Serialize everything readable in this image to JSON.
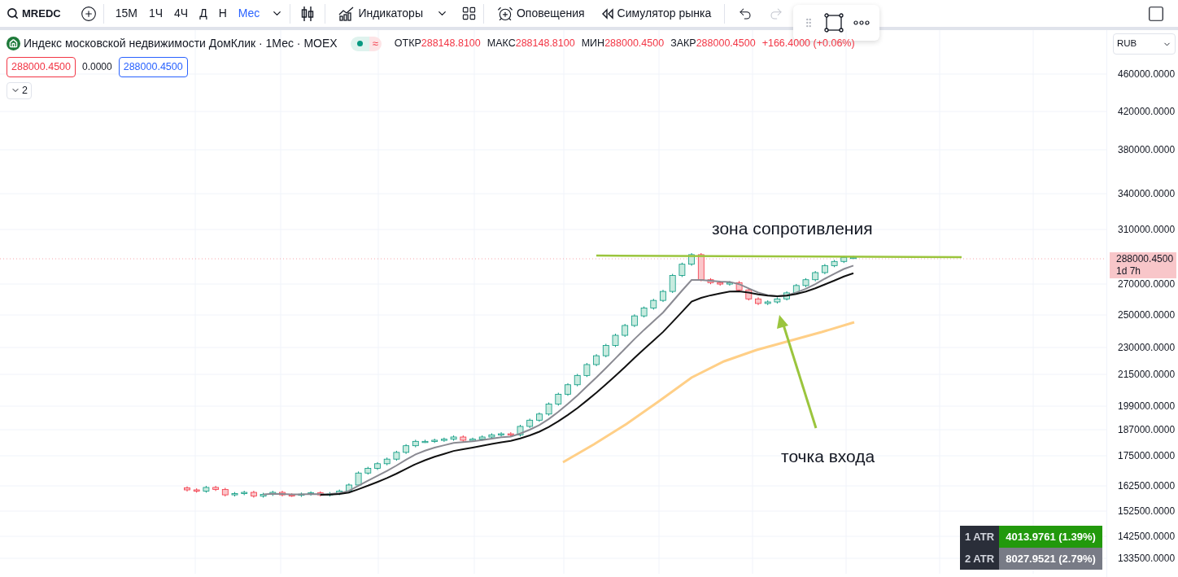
{
  "toolbar": {
    "symbol": "MREDC",
    "intervals": [
      {
        "label": "15М",
        "selected": false
      },
      {
        "label": "1Ч",
        "selected": false
      },
      {
        "label": "4Ч",
        "selected": false
      },
      {
        "label": "Д",
        "selected": false
      },
      {
        "label": "Н",
        "selected": false
      },
      {
        "label": "Мес",
        "selected": true
      }
    ],
    "indicators_label": "Индикаторы",
    "alerts_label": "Оповещения",
    "replay_label": "Симулятор рынка"
  },
  "legend": {
    "title": "Индекс московской недвижимости ДомКлик · 1Мес · MOEX",
    "ohlc": [
      {
        "label": "ОТКР",
        "value": "288148.8100"
      },
      {
        "label": "МАКС",
        "value": "288148.8100"
      },
      {
        "label": "МИН",
        "value": "288000.4500"
      },
      {
        "label": "ЗАКР",
        "value": "288000.4500"
      }
    ],
    "status_symbol": "≈",
    "change": "+166.4000 (+0.06%)",
    "sell": "288000.4500",
    "spread": "0.0000",
    "buy": "288000.4500",
    "indicators_count": "2"
  },
  "currency": "RUB",
  "price_axis": {
    "ticks": [
      "460000.0000",
      "420000.0000",
      "380000.0000",
      "340000.0000",
      "310000.0000",
      "270000.0000",
      "250000.0000",
      "230000.0000",
      "215000.0000",
      "199000.0000",
      "187000.0000",
      "175000.0000",
      "162500.0000",
      "152500.0000",
      "142500.0000",
      "133500.0000"
    ],
    "last_price": "288000.4500",
    "countdown": "1d 7h"
  },
  "annotations": [
    {
      "text": "зона сопротивления"
    },
    {
      "text": "точка входа"
    }
  ],
  "atr_table": [
    {
      "label": "1 ATR",
      "value": "4013.9761 (1.39%)",
      "color": "#22990c"
    },
    {
      "label": "2 ATR",
      "value": "8027.9521 (2.79%)",
      "color": "#787b86"
    }
  ]
}
